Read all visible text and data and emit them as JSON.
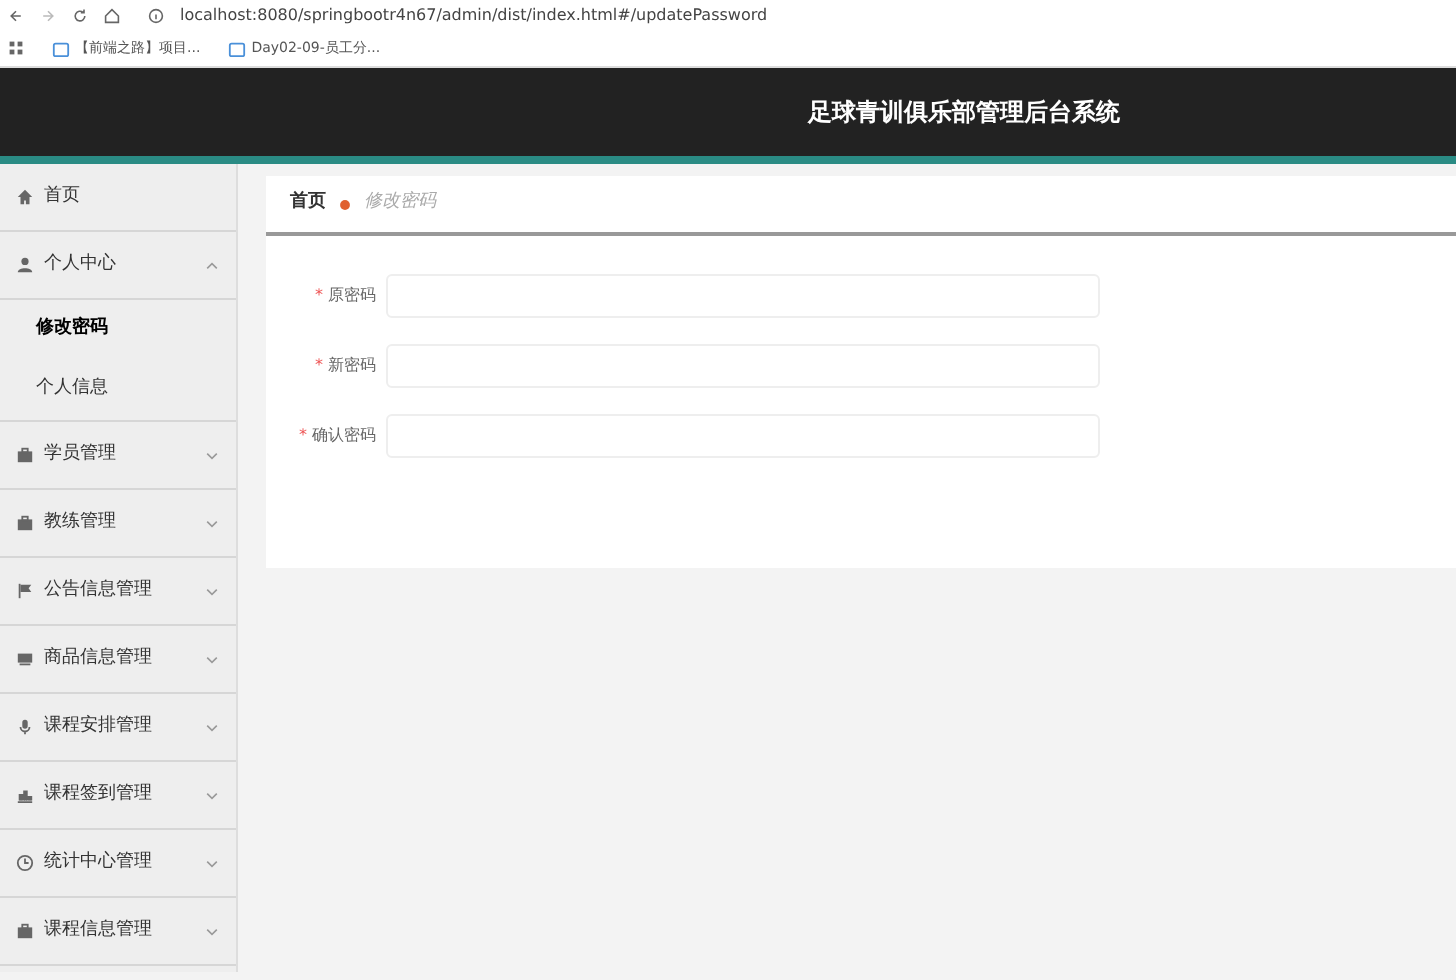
{
  "browser": {
    "url": "localhost:8080/springbootr4n67/admin/dist/index.html#/updatePassword",
    "bookmarks": [
      "【前端之路】项目...",
      "Day02-09-员工分..."
    ]
  },
  "header": {
    "title": "足球青训俱乐部管理后台系统"
  },
  "sidebar": {
    "items": [
      {
        "label": "首页"
      },
      {
        "label": "个人中心",
        "expanded": true,
        "children": [
          {
            "label": "修改密码",
            "selected": true
          },
          {
            "label": "个人信息",
            "selected": false
          }
        ]
      },
      {
        "label": "学员管理",
        "expanded": false
      },
      {
        "label": "教练管理",
        "expanded": false
      },
      {
        "label": "公告信息管理",
        "expanded": false
      },
      {
        "label": "商品信息管理",
        "expanded": false
      },
      {
        "label": "课程安排管理",
        "expanded": false
      },
      {
        "label": "课程签到管理",
        "expanded": false
      },
      {
        "label": "统计中心管理",
        "expanded": false
      },
      {
        "label": "课程信息管理",
        "expanded": false
      }
    ]
  },
  "breadcrumb": [
    {
      "label": "首页",
      "current": false
    },
    {
      "label": "修改密码",
      "current": true
    }
  ],
  "form": {
    "fields": [
      {
        "label": "原密码",
        "required_mark": "*"
      },
      {
        "label": "新密码",
        "required_mark": "*"
      },
      {
        "label": "确认密码",
        "required_mark": "*"
      }
    ]
  }
}
